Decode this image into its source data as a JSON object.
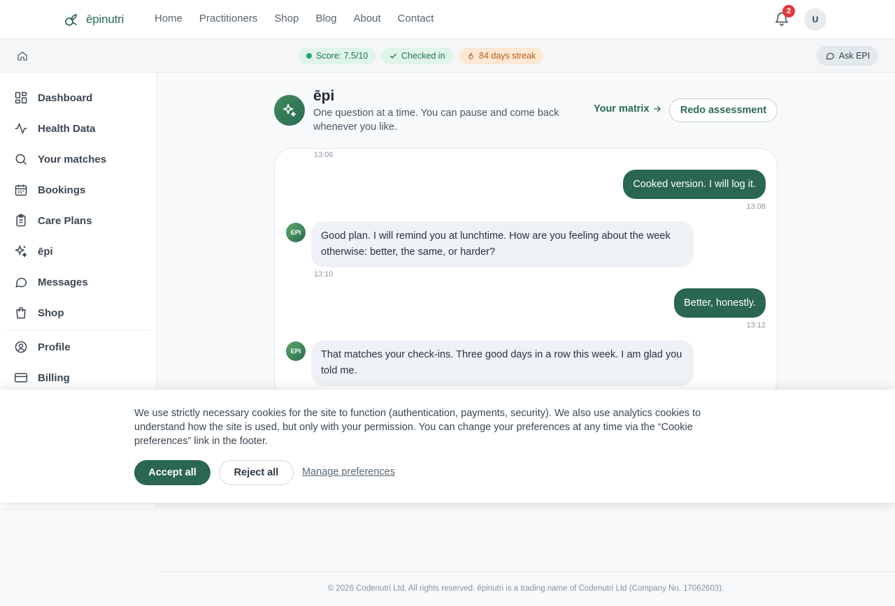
{
  "brand": {
    "name": "ēpinutri"
  },
  "nav": {
    "links": [
      "Home",
      "Practitioners",
      "Shop",
      "Blog",
      "About",
      "Contact"
    ]
  },
  "header": {
    "notification_count": "2",
    "avatar_initial": "U"
  },
  "subbar": {
    "score_label": "Score: 7.5/10",
    "checked_label": "Checked in",
    "streak_label": "84 days streak",
    "ask_label": "Ask EPI"
  },
  "sidebar": {
    "items": [
      {
        "label": "Dashboard",
        "icon": "dashboard-icon"
      },
      {
        "label": "Health Data",
        "icon": "activity-icon"
      },
      {
        "label": "Your matches",
        "icon": "search-icon"
      },
      {
        "label": "Bookings",
        "icon": "calendar-icon"
      },
      {
        "label": "Care Plans",
        "icon": "clipboard-icon"
      },
      {
        "label": "ēpi",
        "icon": "sparkles-icon"
      },
      {
        "label": "Messages",
        "icon": "message-icon"
      },
      {
        "label": "Shop",
        "icon": "shopping-bag-icon"
      },
      {
        "label": "Profile",
        "icon": "user-circle-icon"
      },
      {
        "label": "Billing",
        "icon": "credit-card-icon"
      }
    ]
  },
  "main": {
    "title": "ēpi",
    "subtitle": "One question at a time. You can pause and come back whenever you like.",
    "matrix_link": "Your matrix",
    "redo_label": "Redo assessment"
  },
  "chat": {
    "bot_avatar_label": "EPI",
    "messages": [
      {
        "from": "bot-time",
        "time": "13:06"
      },
      {
        "from": "user",
        "text": "Cooked version. I will log it.",
        "time": "13:08"
      },
      {
        "from": "bot",
        "text": "Good plan. I will remind you at lunchtime. How are you feeling about the week otherwise: better, the same, or harder?",
        "time": "13:10"
      },
      {
        "from": "user",
        "text": "Better, honestly.",
        "time": "13:12"
      },
      {
        "from": "bot",
        "text": "That matches your check-ins. Three good days in a row this week. I am glad you told me."
      }
    ]
  },
  "cookie": {
    "text": "We use strictly necessary cookies for the site to function (authentication, payments, security). We also use analytics cookies to understand how the site is used, but only with your permission. You can change your preferences at any time via the “Cookie preferences” link in the footer.",
    "accept_label": "Accept all",
    "reject_label": "Reject all",
    "manage_label": "Manage preferences"
  },
  "footer": {
    "text": "© 2026 Codenutri Ltd. All rights reserved. ēpinutri is a trading name of Codenutri Ltd (Company No. 17062603)."
  },
  "colors": {
    "brand": "#2c6b52",
    "badge": "#e23b3b",
    "streak": "#b25c17"
  }
}
